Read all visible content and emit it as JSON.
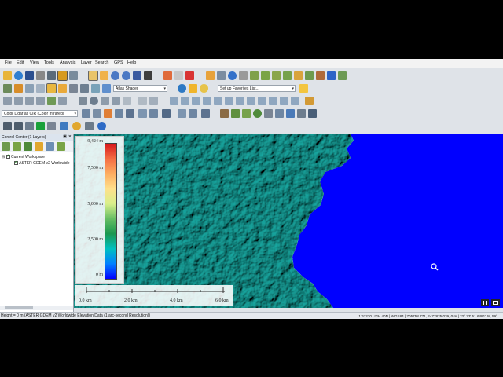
{
  "menu": [
    "File",
    "Edit",
    "View",
    "Tools",
    "Analysis",
    "Layer",
    "Search",
    "GPS",
    "Help"
  ],
  "toolbar": {
    "shader_select": "Atlas Shader",
    "favorites_select": "Set up Favorites List...",
    "lidar_select": "Color Lidar as CIR (Color Infrared)"
  },
  "control_center": {
    "title": "Control Center (1 Layers)",
    "workspace": "Current Workspace",
    "layer": "ASTER GDEM v2 Worldwide"
  },
  "legend": {
    "labels": [
      "9,424 m",
      "7,500 m",
      "5,000 m",
      "2,500 m",
      "0 m"
    ],
    "label_values_m": [
      9424,
      7500,
      5000,
      2500,
      0
    ],
    "range_m": [
      0,
      9424
    ],
    "gradient": [
      "#d7191c",
      "#f46d43",
      "#fdae61",
      "#fee08b",
      "#d9ef8b",
      "#66bd63",
      "#1a9850",
      "#00c0c0",
      "#0080ff",
      "#0000ff"
    ]
  },
  "scale": {
    "labels": [
      "0.0 km",
      "2.0 km",
      "4.0 km",
      "6.0 km"
    ]
  },
  "status": {
    "left": "Height = 0 m (ASTER GDEM v2 Worldwide Elevation Data (1 arc-second Resolution))",
    "right": "1:61220  UTM 40N | WGS84 | 705758.771, 2477825.039, 0 m | 22° 23' 51.6481\" N, 59° ..."
  },
  "colors": {
    "water": "#0000ff",
    "terrain": "#1aa9a2"
  }
}
